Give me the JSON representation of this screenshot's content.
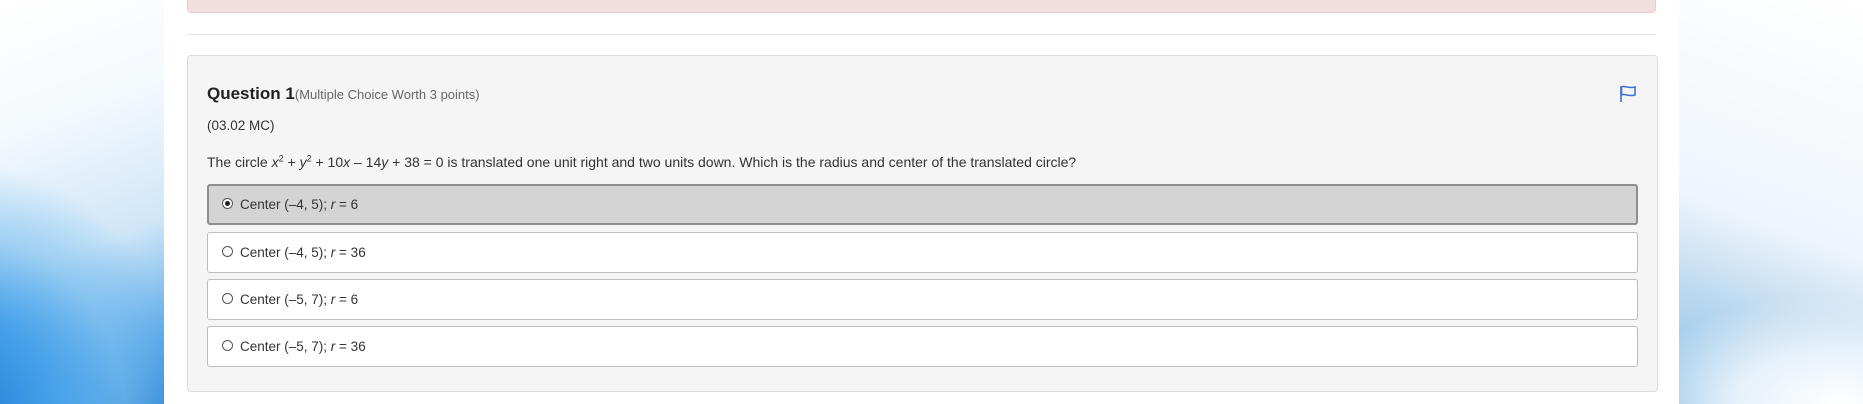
{
  "alert": {
    "text": ""
  },
  "question": {
    "title": "Question 1",
    "worth": "(Multiple Choice Worth 3 points)",
    "code": "(03.02 MC)",
    "text": {
      "prefix": "The circle ",
      "x": "x",
      "x_exp": "2",
      "plus1": " + ",
      "y": "y",
      "y_exp": "2",
      "mid1": " + 10",
      "x2": "x",
      "mid2": " – 14",
      "y2": "y",
      "suffix": " + 38 = 0 is translated one unit right and two units down. Which is the radius and center of the translated circle?"
    },
    "flag_icon": "flag-icon"
  },
  "options": [
    {
      "center": "Center (–4, 5); ",
      "r": "r",
      "value": " = 6",
      "selected": true
    },
    {
      "center": "Center (–4, 5); ",
      "r": "r",
      "value": " = 36",
      "selected": false
    },
    {
      "center": "Center (–5, 7); ",
      "r": "r",
      "value": " = 6",
      "selected": false
    },
    {
      "center": "Center (–5, 7); ",
      "r": "r",
      "value": " = 36",
      "selected": false
    }
  ],
  "colors": {
    "selected_bg": "#d4d4d4",
    "panel_bg": "#f5f5f5",
    "flag": "#3b6fd6",
    "alert_bg": "#f2dede"
  }
}
